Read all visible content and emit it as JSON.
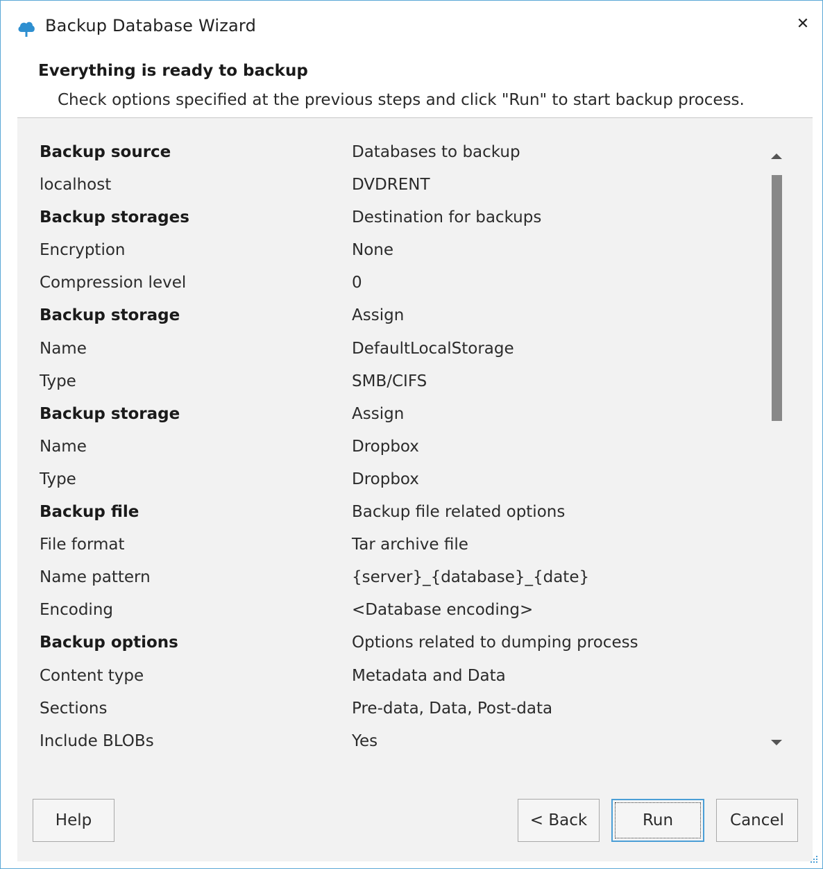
{
  "window": {
    "title": "Backup Database Wizard",
    "icon": "cloud-icon",
    "close_glyph": "✕"
  },
  "header": {
    "title": "Everything is ready to backup",
    "subtitle": "Check options specified at the previous steps and click \"Run\" to start backup process."
  },
  "summary": {
    "rows": [
      {
        "key": "Backup source",
        "value": "Databases to backup",
        "bold": true
      },
      {
        "key": "localhost",
        "value": "DVDRENT",
        "bold": false
      },
      {
        "key": "Backup storages",
        "value": "Destination for backups",
        "bold": true
      },
      {
        "key": "Encryption",
        "value": "None",
        "bold": false
      },
      {
        "key": "Compression level",
        "value": "0",
        "bold": false
      },
      {
        "key": "Backup storage",
        "value": "Assign",
        "bold": true
      },
      {
        "key": "Name",
        "value": "DefaultLocalStorage",
        "bold": false
      },
      {
        "key": "Type",
        "value": "SMB/CIFS",
        "bold": false
      },
      {
        "key": "Backup storage",
        "value": "Assign",
        "bold": true
      },
      {
        "key": "Name",
        "value": "Dropbox",
        "bold": false
      },
      {
        "key": "Type",
        "value": "Dropbox",
        "bold": false
      },
      {
        "key": "Backup file",
        "value": "Backup file related options",
        "bold": true
      },
      {
        "key": "File format",
        "value": "Tar archive file",
        "bold": false
      },
      {
        "key": "Name pattern",
        "value": "{server}_{database}_{date}",
        "bold": false
      },
      {
        "key": "Encoding",
        "value": "<Database encoding>",
        "bold": false
      },
      {
        "key": "Backup options",
        "value": "Options related to dumping process",
        "bold": true
      },
      {
        "key": "Content type",
        "value": "Metadata and Data",
        "bold": false
      },
      {
        "key": "Sections",
        "value": "Pre-data, Data, Post-data",
        "bold": false
      },
      {
        "key": "Include BLOBs",
        "value": "Yes",
        "bold": false
      }
    ]
  },
  "buttons": {
    "help": "Help",
    "back": "< Back",
    "run": "Run",
    "cancel": "Cancel"
  },
  "colors": {
    "accent": "#4a9ed6",
    "icon": "#2e8fd0",
    "panel": "#f2f2f2",
    "scroll_thumb": "#888888"
  }
}
